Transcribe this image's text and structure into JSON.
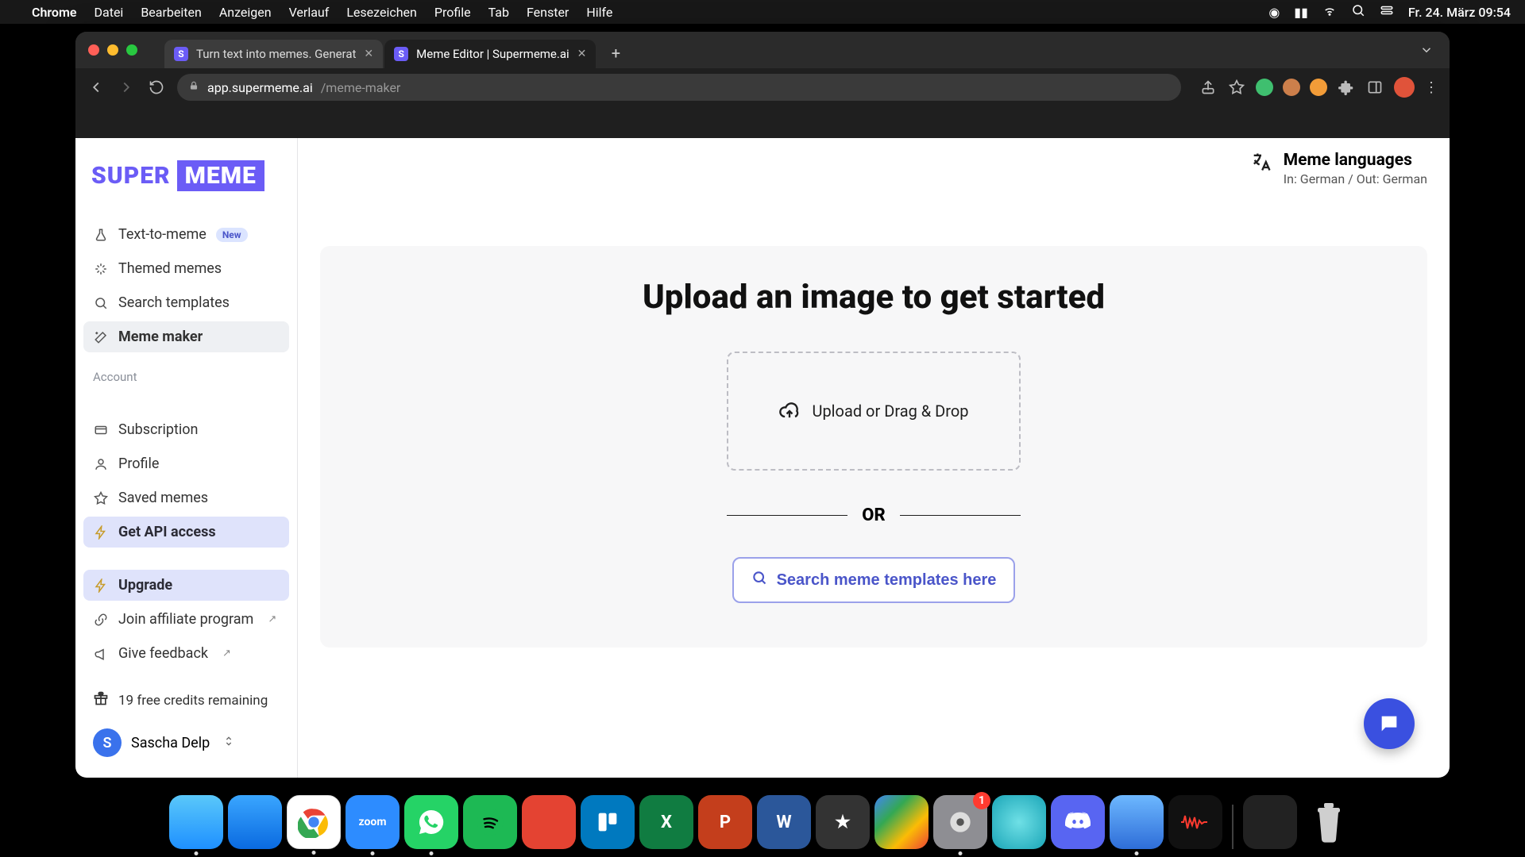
{
  "mac_menu": {
    "app": "Chrome",
    "items": [
      "Datei",
      "Bearbeiten",
      "Anzeigen",
      "Verlauf",
      "Lesezeichen",
      "Profile",
      "Tab",
      "Fenster",
      "Hilfe"
    ],
    "clock": "Fr. 24. März  09:54"
  },
  "tabs": {
    "t0": {
      "title": "Turn text into memes. Generat"
    },
    "t1": {
      "title": "Meme Editor | Supermeme.ai"
    }
  },
  "url": {
    "host": "app.supermeme.ai",
    "path": "/meme-maker"
  },
  "logo": {
    "left": "SUPER",
    "right": "MEME"
  },
  "sidebar": {
    "text_to_meme": "Text-to-meme",
    "new_badge": "New",
    "themed": "Themed memes",
    "search_templates": "Search templates",
    "meme_maker": "Meme maker",
    "account_label": "Account",
    "subscription": "Subscription",
    "profile": "Profile",
    "saved": "Saved memes",
    "api": "Get API access",
    "upgrade": "Upgrade",
    "affiliate": "Join affiliate program",
    "feedback": "Give feedback",
    "credits": "19 free credits remaining"
  },
  "user": {
    "initial": "S",
    "name": "Sascha Delp"
  },
  "lang": {
    "title": "Meme languages",
    "sub": "In: German / Out: German"
  },
  "main": {
    "heading": "Upload an image to get started",
    "drop": "Upload or Drag & Drop",
    "or": "OR",
    "search": "Search meme templates here"
  },
  "settings_badge": "1"
}
